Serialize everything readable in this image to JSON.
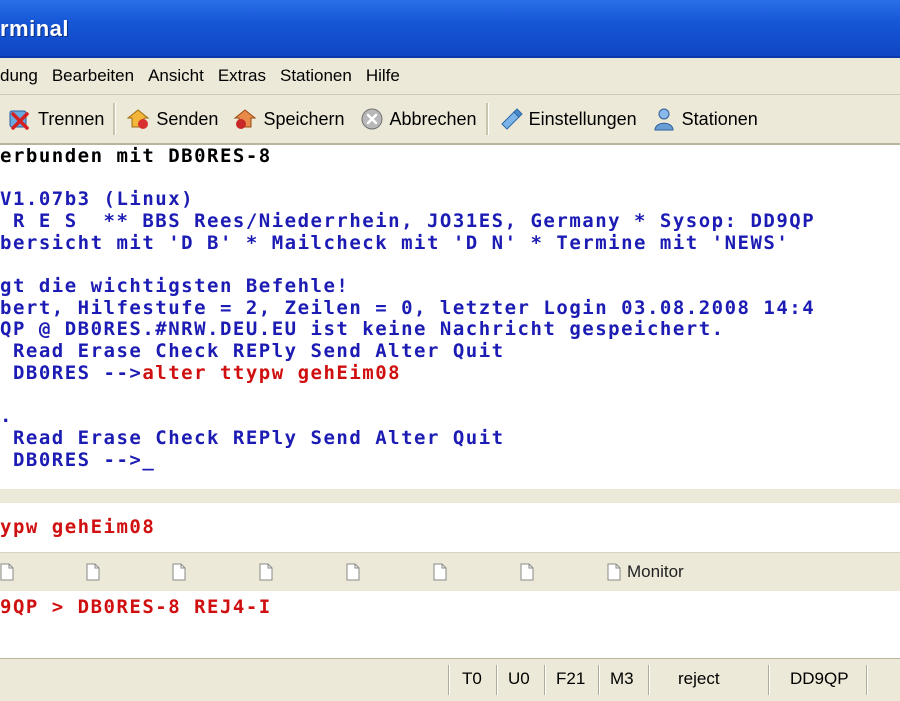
{
  "window": {
    "title": "rminal"
  },
  "menu": {
    "items": [
      "dung",
      "Bearbeiten",
      "Ansicht",
      "Extras",
      "Stationen",
      "Hilfe"
    ]
  },
  "toolbar": {
    "trennen": "Trennen",
    "senden": "Senden",
    "speichern": "Speichern",
    "abbrechen": "Abbrechen",
    "einstellungen": "Einstellungen",
    "stationen": "Stationen"
  },
  "terminal": {
    "lines": [
      {
        "text": "erbunden mit DB0RES-8",
        "color": "#000000"
      },
      {
        "text": "",
        "color": "#1c1cb4"
      },
      {
        "text": "V1.07b3 (Linux)",
        "color": "#1c1cb4"
      },
      {
        "text": " R E S  ** BBS Rees/Niederrhein, JO31ES, Germany * Sysop: DD9QP",
        "color": "#1c1cb4"
      },
      {
        "text": "bersicht mit 'D B' * Mailcheck mit 'D N' * Termine mit 'NEWS'",
        "color": "#1c1cb4"
      },
      {
        "text": "",
        "color": "#1c1cb4"
      },
      {
        "text": "gt die wichtigsten Befehle!",
        "color": "#1c1cb4"
      },
      {
        "text": "bert, Hilfestufe = 2, Zeilen = 0, letzter Login 03.08.2008 14:4",
        "color": "#1c1cb4"
      },
      {
        "text": "QP @ DB0RES.#NRW.DEU.EU ist keine Nachricht gespeichert.",
        "color": "#1c1cb4"
      },
      {
        "text": " Read Erase Check REPly Send Alter Quit",
        "color": "#1c1cb4"
      },
      {
        "text": " DB0RES -->",
        "color": "#1c1cb4",
        "suffix": "alter ttypw gehEim08",
        "suffix_color": "#d01010"
      },
      {
        "text": "",
        "color": "#1c1cb4"
      },
      {
        "text": ".",
        "color": "#1c1cb4"
      },
      {
        "text": " Read Erase Check REPly Send Alter Quit",
        "color": "#1c1cb4"
      },
      {
        "text": " DB0RES -->_",
        "color": "#1c1cb4"
      }
    ]
  },
  "input": {
    "value": "ypw gehEim08"
  },
  "tabs": {
    "monitor_label": "Monitor"
  },
  "monitor": {
    "line": "9QP > DB0RES-8 REJ4-I"
  },
  "status": {
    "t0": "T0",
    "u0": "U0",
    "f21": "F21",
    "m3": "M3",
    "state": "reject",
    "callsign": "DD9QP"
  },
  "colors": {
    "titlebar": "#1656d6",
    "chrome": "#ece9d8",
    "text_blue": "#1c1cb4",
    "text_red": "#d01010"
  }
}
